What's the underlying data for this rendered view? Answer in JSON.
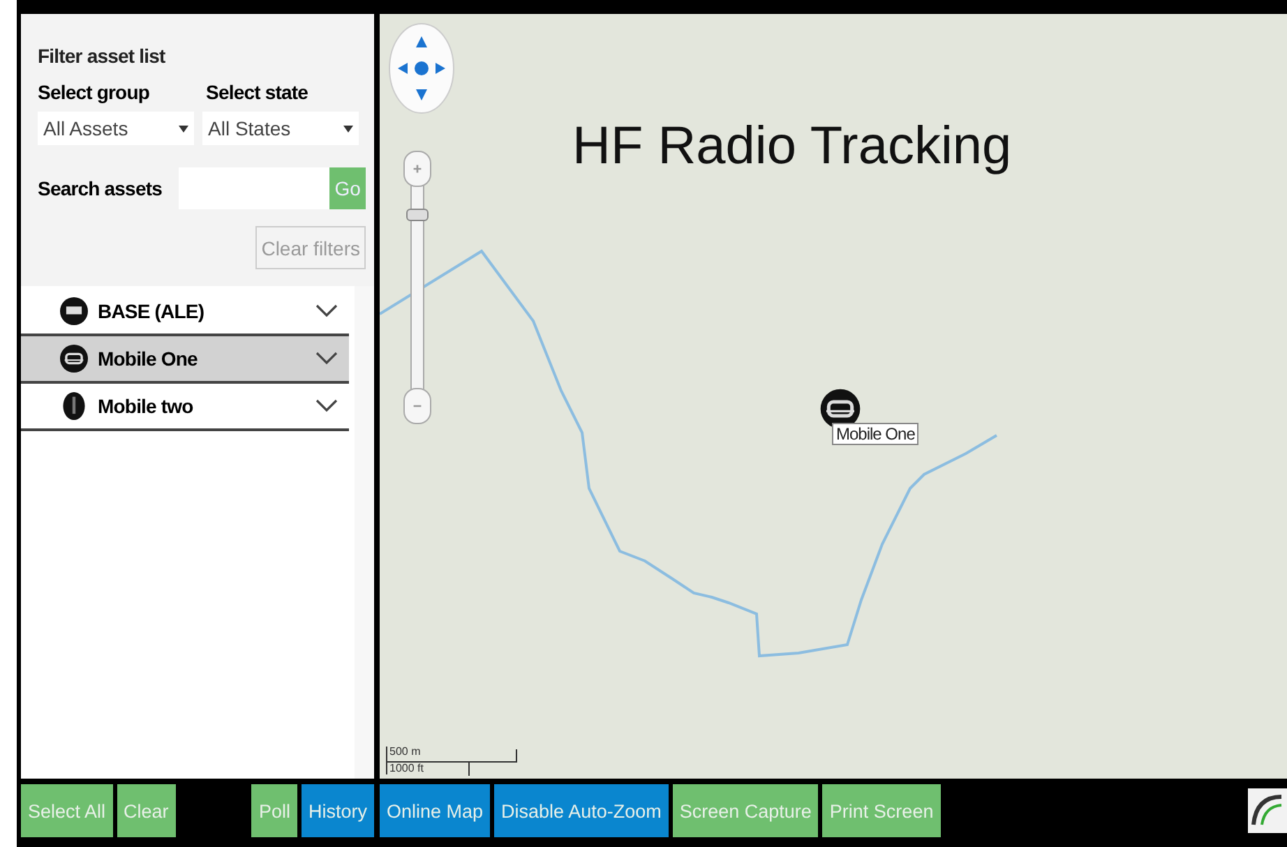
{
  "filter_panel": {
    "title": "Filter asset list",
    "group_label": "Select group",
    "state_label": "Select state",
    "group_value": "All Assets",
    "state_value": "All States",
    "search_label": "Search assets",
    "go_button": "Go",
    "clear_filters_button": "Clear filters"
  },
  "assets": [
    {
      "name": "BASE (ALE)",
      "kind": "base",
      "selected": false
    },
    {
      "name": "Mobile One",
      "kind": "vehicle",
      "selected": true
    },
    {
      "name": "Mobile two",
      "kind": "handheld",
      "selected": false
    }
  ],
  "map": {
    "title": "HF Radio Tracking",
    "marker_label": "Mobile One",
    "zoom": {
      "level": 0.8
    },
    "scale_metric": "500 m",
    "scale_imperial": "1000 ft"
  },
  "left_buttons": [
    {
      "label": "Select All",
      "color": "#6fbf6f"
    },
    {
      "label": "Clear",
      "color": "#6fbf6f"
    },
    {
      "label": "Poll",
      "color": "#6fbf6f"
    },
    {
      "label": "History",
      "color": "#0a86cf"
    }
  ],
  "map_buttons": [
    {
      "label": "Online Map",
      "color": "#0a86cf"
    },
    {
      "label": "Disable Auto-Zoom",
      "color": "#0a86cf"
    },
    {
      "label": "Screen Capture",
      "color": "#6fbf6f"
    },
    {
      "label": "Print Screen",
      "color": "#6fbf6f"
    }
  ]
}
